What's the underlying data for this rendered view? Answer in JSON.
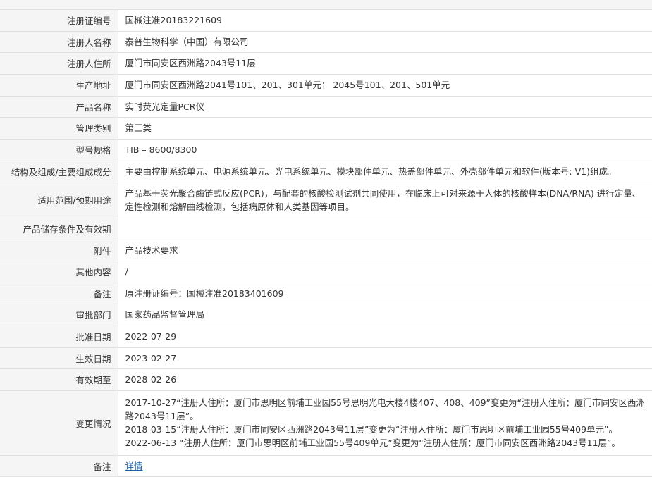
{
  "rows": [
    {
      "label": "注册证编号",
      "value": "国械注准20183221609"
    },
    {
      "label": "注册人名称",
      "value": "泰普生物科学（中国）有限公司"
    },
    {
      "label": "注册人住所",
      "value": "厦门市同安区西洲路2043号11层"
    },
    {
      "label": "生产地址",
      "value": "厦门市同安区西洲路2041号101、201、301单元； 2045号101、201、501单元"
    },
    {
      "label": "产品名称",
      "value": "实时荧光定量PCR仪"
    },
    {
      "label": "管理类别",
      "value": "第三类"
    },
    {
      "label": "型号规格",
      "value": "TIB – 8600/8300"
    },
    {
      "label": "结构及组成/主要组成成分",
      "value": "主要由控制系统单元、电源系统单元、光电系统单元、模块部件单元、热盖部件单元、外壳部件单元和软件(版本号: V1)组成。"
    },
    {
      "label": "适用范围/预期用途",
      "value": "产品基于荧光聚合酶链式反应(PCR)，与配套的核酸检测试剂共同使用，在临床上可对来源于人体的核酸样本(DNA/RNA) 进行定量、定性检测和熔解曲线检测，包括病原体和人类基因等项目。"
    },
    {
      "label": "产品储存条件及有效期",
      "value": ""
    },
    {
      "label": "附件",
      "value": "产品技术要求"
    },
    {
      "label": "其他内容",
      "value": "/"
    },
    {
      "label": "备注",
      "value": "原注册证编号：国械注准20183401609"
    },
    {
      "label": "审批部门",
      "value": "国家药品监督管理局"
    },
    {
      "label": "批准日期",
      "value": "2022-07-29"
    },
    {
      "label": "生效日期",
      "value": "2023-02-27"
    },
    {
      "label": "有效期至",
      "value": "2028-02-26"
    }
  ],
  "changes": {
    "label": "变更情况",
    "items": [
      "2017-10-27“注册人住所：厦门市思明区前埔工业园55号思明光电大楼4楼407、408、409”变更为“注册人住所：厦门市同安区西洲路2043号11层”。",
      "2018-03-15“注册人住所：厦门市同安区西洲路2043号11层”变更为“注册人住所：厦门市思明区前埔工业园55号409单元”。",
      "2022-06-13 “注册人住所：厦门市思明区前埔工业园55号409单元”变更为“注册人住所：厦门市同安区西洲路2043号11层”。"
    ]
  },
  "notes": {
    "label": "备注",
    "link": "详情"
  }
}
